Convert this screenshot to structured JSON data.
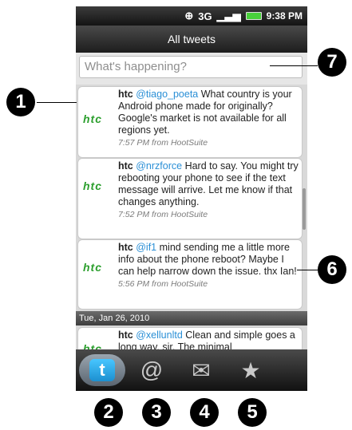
{
  "status_bar": {
    "time": "9:38 PM",
    "network": "3G"
  },
  "title_bar": {
    "title": "All tweets"
  },
  "compose": {
    "placeholder": "What's happening?"
  },
  "tweets": [
    {
      "logo": "htc",
      "author": "htc",
      "user": "@tiago_poeta",
      "text": "What country is your Android phone made for originally? Google's market is not available for all regions yet.",
      "meta": "7:57 PM from HootSuite"
    },
    {
      "logo": "htc",
      "author": "htc",
      "user": "@nrzforce",
      "text": "Hard to say. You might try rebooting your phone to see if the text message will arrive. Let me know if that changes anything.",
      "meta": "7:52 PM from HootSuite"
    },
    {
      "logo": "htc",
      "author": "htc",
      "user": "@if1",
      "text": "mind sending me a little more info about the phone reboot? Maybe I can help narrow down the issue. thx Ian!",
      "meta": "5:56 PM from HootSuite"
    },
    {
      "logo": "htc",
      "author": "htc",
      "user": "@xellunltd",
      "text": "Clean and simple goes a long way, sir. The minimal",
      "meta": ""
    }
  ],
  "date_header": "Tue, Jan 26, 2010",
  "tabs": [
    {
      "name": "twitter",
      "icon": "twitter-icon",
      "glyph": "t"
    },
    {
      "name": "mentions",
      "icon": "at-icon",
      "glyph": "@"
    },
    {
      "name": "messages",
      "icon": "envelope-icon",
      "glyph": "✉"
    },
    {
      "name": "favorites",
      "icon": "star-icon",
      "glyph": "★"
    }
  ],
  "callouts": {
    "c1": "1",
    "c2": "2",
    "c3": "3",
    "c4": "4",
    "c5": "5",
    "c6": "6",
    "c7": "7"
  }
}
